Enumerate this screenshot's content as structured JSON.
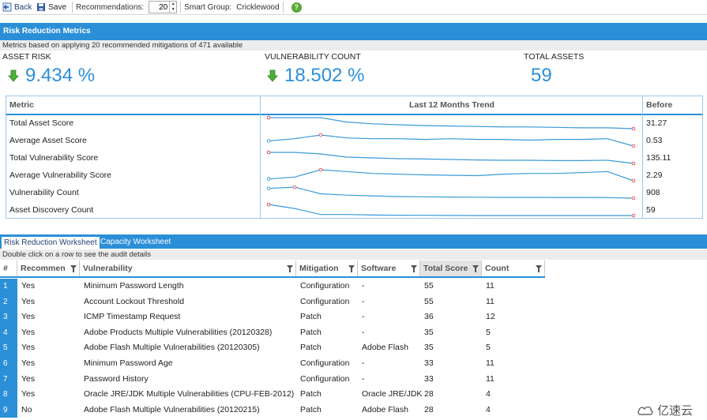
{
  "toolbar": {
    "back_label": "Back",
    "save_label": "Save",
    "recommendations_label": "Recommendations:",
    "recommendations_value": "20",
    "smart_group_label": "Smart Group:",
    "smart_group_value": "Cricklewood"
  },
  "header": {
    "title": "Risk Reduction Metrics",
    "note": "Metrics based on applying 20 recommended mitigations of 471 available"
  },
  "kpis": [
    {
      "label": "ASSET RISK",
      "value": "9.434 %",
      "trend": "down"
    },
    {
      "label": "VULNERABILITY COUNT",
      "value": "18.502 %",
      "trend": "down"
    },
    {
      "label": "TOTAL ASSETS",
      "value": "59"
    }
  ],
  "metrics": {
    "columns": [
      "Metric",
      "Last 12 Months Trend",
      "Before"
    ],
    "rows": [
      {
        "metric": "Total Asset Score",
        "before": "31.27",
        "trend": [
          30,
          30,
          30,
          29,
          28.6,
          28.4,
          28.2,
          28.1,
          28,
          27.9,
          27.9,
          27.8,
          27.7,
          27.7,
          27.5
        ]
      },
      {
        "metric": "Average Asset Score",
        "before": "0.53",
        "trend": [
          0.47,
          0.5,
          0.55,
          0.51,
          0.5,
          0.5,
          0.49,
          0.5,
          0.49,
          0.49,
          0.48,
          0.49,
          0.49,
          0.5,
          0.4
        ]
      },
      {
        "metric": "Total Vulnerability Score",
        "before": "135.11",
        "trend": [
          142,
          142,
          141,
          139,
          138.5,
          138,
          137.8,
          137.5,
          137.2,
          137,
          137,
          136.8,
          136.8,
          137,
          135
        ]
      },
      {
        "metric": "Average Vulnerability Score",
        "before": "2.29",
        "trend": [
          2.05,
          2.1,
          2.3,
          2.25,
          2.2,
          2.18,
          2.16,
          2.15,
          2.14,
          2.18,
          2.2,
          2.2,
          2.22,
          2.25,
          2.0
        ]
      },
      {
        "metric": "Vulnerability Count",
        "before": "908",
        "trend": [
          980,
          990,
          940,
          930,
          925,
          920,
          918,
          916,
          915,
          914,
          914,
          913,
          913,
          912,
          908
        ]
      },
      {
        "metric": "Asset Discovery Count",
        "before": "59",
        "trend": [
          70,
          66,
          60,
          60,
          59.5,
          59.3,
          59.2,
          59.1,
          59,
          59,
          59,
          59,
          59,
          59,
          59
        ]
      }
    ]
  },
  "tabs": [
    "Risk Reduction Worksheet",
    "Capacity Worksheet"
  ],
  "hint": "Double click on a row to see the audit details",
  "grid": {
    "columns": [
      "#",
      "Recommen",
      "Vulnerability",
      "Mitigation",
      "Software",
      "Total Score",
      "Count"
    ],
    "rows": [
      [
        "1",
        "Yes",
        "Minimum Password Length",
        "Configuration",
        "-",
        "55",
        "11"
      ],
      [
        "2",
        "Yes",
        "Account Lockout Threshold",
        "Configuration",
        "-",
        "55",
        "11"
      ],
      [
        "3",
        "Yes",
        "ICMP Timestamp Request",
        "Patch",
        "-",
        "36",
        "12"
      ],
      [
        "4",
        "Yes",
        "Adobe Products Multiple Vulnerabilities (20120328)",
        "Patch",
        "-",
        "35",
        "5"
      ],
      [
        "5",
        "Yes",
        "Adobe Flash Multiple Vulnerabilities (20120305)",
        "Patch",
        "Adobe Flash",
        "35",
        "5"
      ],
      [
        "6",
        "Yes",
        "Minimum Password Age",
        "Configuration",
        "-",
        "33",
        "11"
      ],
      [
        "7",
        "Yes",
        "Password History",
        "Configuration",
        "-",
        "33",
        "11"
      ],
      [
        "8",
        "Yes",
        "Oracle JRE/JDK Multiple Vulnerabilities (CPU-FEB-2012)",
        "Patch",
        "Oracle JRE/JDK",
        "28",
        "4"
      ],
      [
        "9",
        "No",
        "Adobe Flash Multiple Vulnerabilities (20120215)",
        "Patch",
        "Adobe Flash",
        "28",
        "4"
      ]
    ]
  },
  "watermark": "亿速云",
  "colors": {
    "accent": "#2b8fd8",
    "trend_line": "#3a9ad9",
    "trend_marker": "#e05050",
    "up_down_arrow": "#4caf3a"
  }
}
